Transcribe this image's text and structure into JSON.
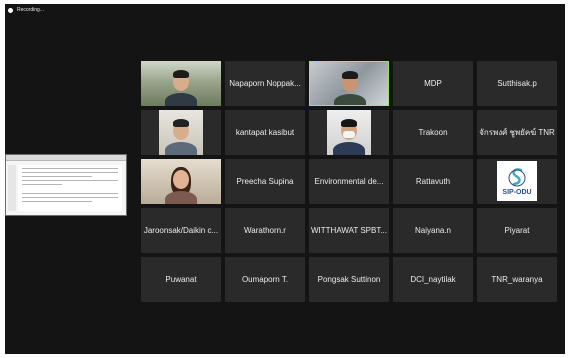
{
  "status": {
    "recording_label": "Recording..."
  },
  "participants": [
    {
      "name": "",
      "kind": "video",
      "active": false
    },
    {
      "name": "Napaporn Noppak...",
      "kind": "name",
      "active": false
    },
    {
      "name": "",
      "kind": "video",
      "active": true
    },
    {
      "name": "MDP",
      "kind": "name",
      "active": false
    },
    {
      "name": "Sutthisak.p",
      "kind": "name",
      "active": false
    },
    {
      "name": "",
      "kind": "video",
      "active": false
    },
    {
      "name": "kantapat kasibut",
      "kind": "name",
      "active": false
    },
    {
      "name": "",
      "kind": "video",
      "active": false
    },
    {
      "name": "Trakoon",
      "kind": "name",
      "active": false
    },
    {
      "name": "จักรพงศ์ ชูพยัคฆ์ TNR",
      "kind": "name",
      "active": false
    },
    {
      "name": "",
      "kind": "video",
      "active": false
    },
    {
      "name": "Preecha Supina",
      "kind": "name",
      "active": false
    },
    {
      "name": "Environmental de...",
      "kind": "name",
      "active": false
    },
    {
      "name": "Rattavuth",
      "kind": "name",
      "active": false
    },
    {
      "name": "",
      "kind": "logo",
      "active": false,
      "logo_text": "SIP-ODU"
    },
    {
      "name": "Jaroonsak/Daikin c...",
      "kind": "name",
      "active": false
    },
    {
      "name": "Warathorn.r",
      "kind": "name",
      "active": false
    },
    {
      "name": "WITTHAWAT SPBT...",
      "kind": "name",
      "active": false
    },
    {
      "name": "Naiyana.n",
      "kind": "name",
      "active": false
    },
    {
      "name": "Piyarat",
      "kind": "name",
      "active": false
    },
    {
      "name": "Puwanat",
      "kind": "name",
      "active": false
    },
    {
      "name": "Oumaporn T.",
      "kind": "name",
      "active": false
    },
    {
      "name": "Pongsak Suttinon",
      "kind": "name",
      "active": false
    },
    {
      "name": "DCI_naytilak",
      "kind": "name",
      "active": false
    },
    {
      "name": "TNR_waranya",
      "kind": "name",
      "active": false
    }
  ],
  "colors": {
    "tile_bg": "#2a2a2a",
    "active_border": "#9fe36b",
    "screen_bg": "#141414"
  }
}
